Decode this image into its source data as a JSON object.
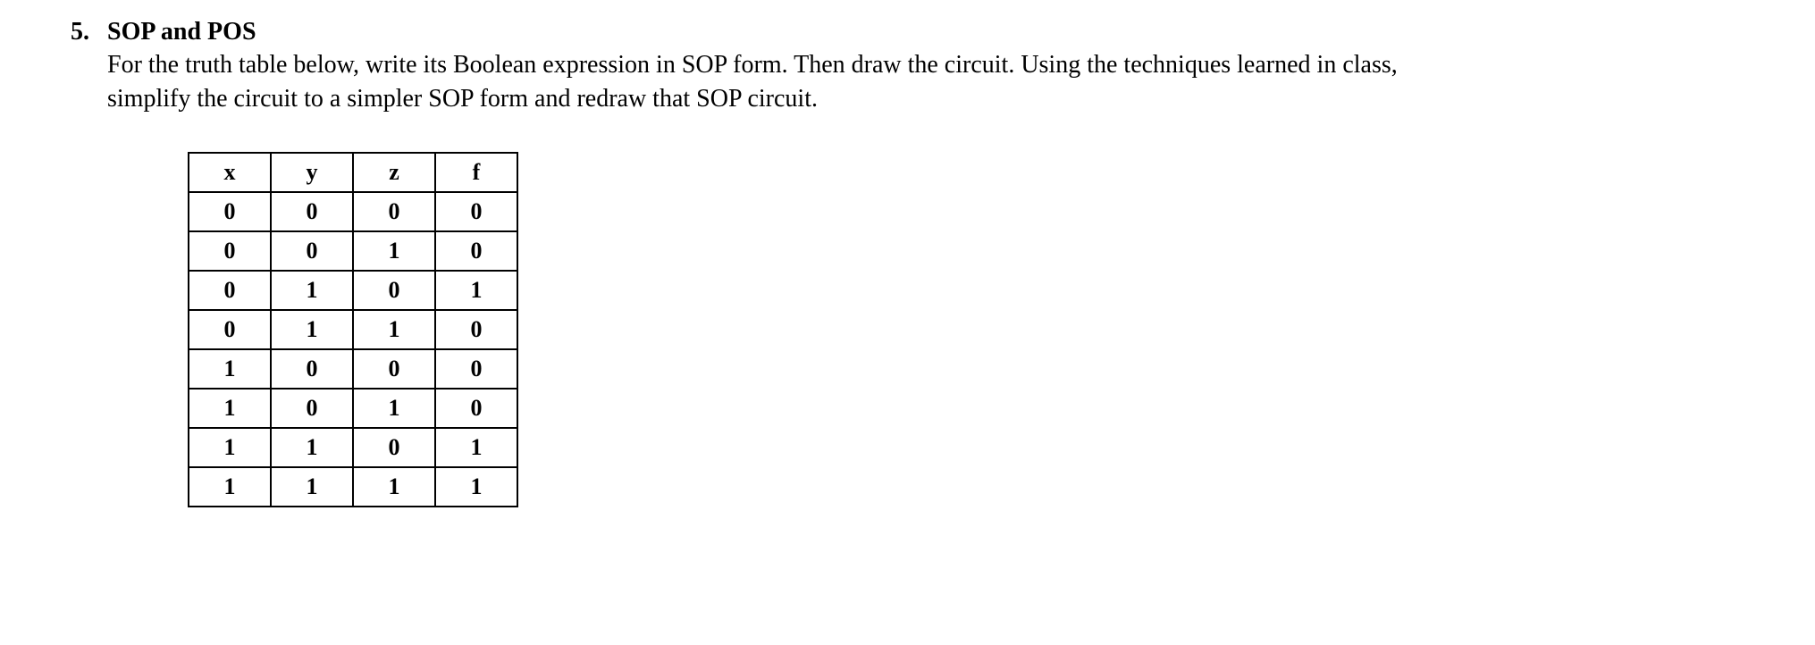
{
  "question": {
    "number": "5.",
    "title": "SOP and POS",
    "prompt": "For the truth table below, write its Boolean expression in SOP form. Then draw the circuit. Using the techniques learned in class, simplify the circuit to a simpler SOP form and redraw that SOP circuit."
  },
  "table": {
    "headers": [
      "x",
      "y",
      "z",
      "f"
    ],
    "rows": [
      [
        "0",
        "0",
        "0",
        "0"
      ],
      [
        "0",
        "0",
        "1",
        "0"
      ],
      [
        "0",
        "1",
        "0",
        "1"
      ],
      [
        "0",
        "1",
        "1",
        "0"
      ],
      [
        "1",
        "0",
        "0",
        "0"
      ],
      [
        "1",
        "0",
        "1",
        "0"
      ],
      [
        "1",
        "1",
        "0",
        "1"
      ],
      [
        "1",
        "1",
        "1",
        "1"
      ]
    ]
  }
}
